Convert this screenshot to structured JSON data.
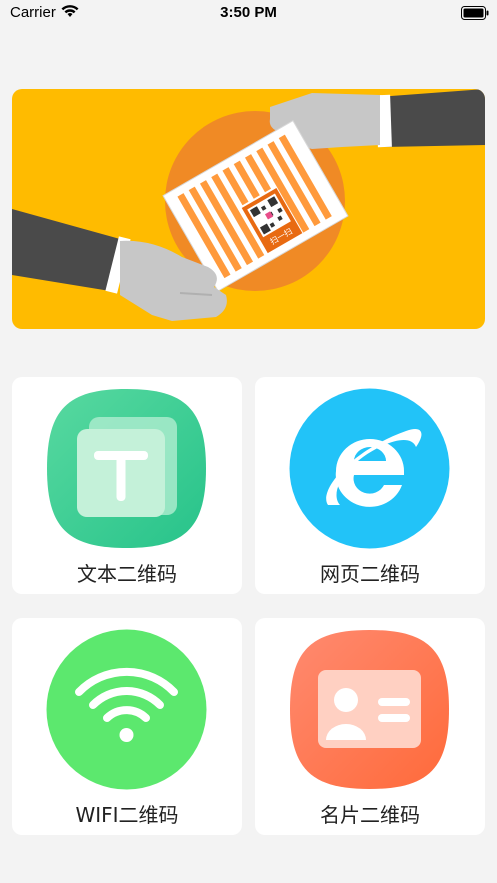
{
  "status_bar": {
    "carrier": "Carrier",
    "time": "3:50 PM"
  },
  "banner": {
    "qr_sign_text": "扫一扫"
  },
  "menu": [
    {
      "label": "文本二维码",
      "icon": "text-icon",
      "color": "#3ecf94"
    },
    {
      "label": "网页二维码",
      "icon": "ie-browser-icon",
      "color": "#22c3f8"
    },
    {
      "label": "WIFI二维码",
      "icon": "wifi-icon",
      "color": "#5ce86e"
    },
    {
      "label": "名片二维码",
      "icon": "business-card-icon",
      "color": "#ff7a55"
    }
  ]
}
